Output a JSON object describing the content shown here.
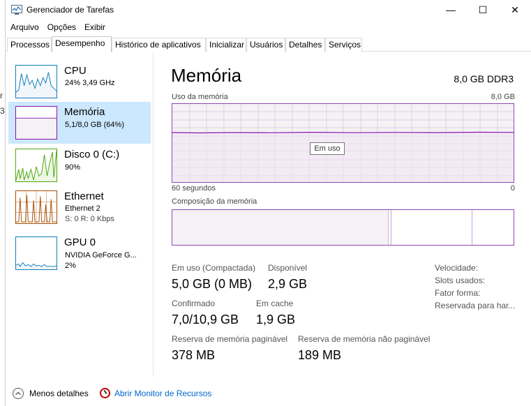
{
  "window": {
    "title": "Gerenciador de Tarefas",
    "controls": {
      "minimize": "—",
      "maximize": "☐",
      "close": "✕"
    }
  },
  "menu": [
    "Arquivo",
    "Opções",
    "Exibir"
  ],
  "tabs": [
    {
      "label": "Processos"
    },
    {
      "label": "Desempenho",
      "active": true
    },
    {
      "label": "Histórico de aplicativos"
    },
    {
      "label": "Inicializar"
    },
    {
      "label": "Usuários"
    },
    {
      "label": "Detalhes"
    },
    {
      "label": "Serviços"
    }
  ],
  "sidebar": {
    "items": [
      {
        "title": "CPU",
        "line1": "24% 3,49 GHz",
        "line2": "",
        "color": "#117dbb"
      },
      {
        "title": "Memória",
        "line1": "5,1/8,0 GB (64%)",
        "line2": "",
        "color": "#8b12ae",
        "selected": true
      },
      {
        "title": "Disco 0 (C:)",
        "line1": "90%",
        "line2": "",
        "color": "#4da60c"
      },
      {
        "title": "Ethernet",
        "line1": "Ethernet 2",
        "line2": "S: 0 R: 0 Kbps",
        "color": "#a74f01"
      },
      {
        "title": "GPU 0",
        "line1": "NVIDIA GeForce G...",
        "line2": "2%",
        "color": "#117dbb"
      }
    ]
  },
  "main": {
    "title": "Memória",
    "spec": "8,0 GB DDR3",
    "usage_label": "Uso da memória",
    "usage_max": "8,0 GB",
    "time_left": "60 segundos",
    "time_right": "0",
    "tooltip": "Em uso",
    "usage_level": 0.64,
    "composition_label": "Composição da memória",
    "accent": "#8e47b9",
    "stats": {
      "in_use_label": "Em uso (Compactada)",
      "in_use_value": "5,0 GB (0 MB)",
      "available_label": "Disponível",
      "available_value": "2,9 GB",
      "committed_label": "Confirmado",
      "committed_value": "7,0/10,9 GB",
      "cached_label": "Em cache",
      "cached_value": "1,9 GB",
      "paged_label": "Reserva de memória paginável",
      "paged_value": "378 MB",
      "nonpaged_label": "Reserva de memória não paginável",
      "nonpaged_value": "189 MB"
    },
    "right": {
      "speed": "Velocidade:",
      "slots": "Slots usados:",
      "form": "Fator forma:",
      "reserved": "Reservada para har..."
    }
  },
  "footer": {
    "less_details": "Menos detalhes",
    "resource_monitor": "Abrir Monitor de Recursos"
  }
}
